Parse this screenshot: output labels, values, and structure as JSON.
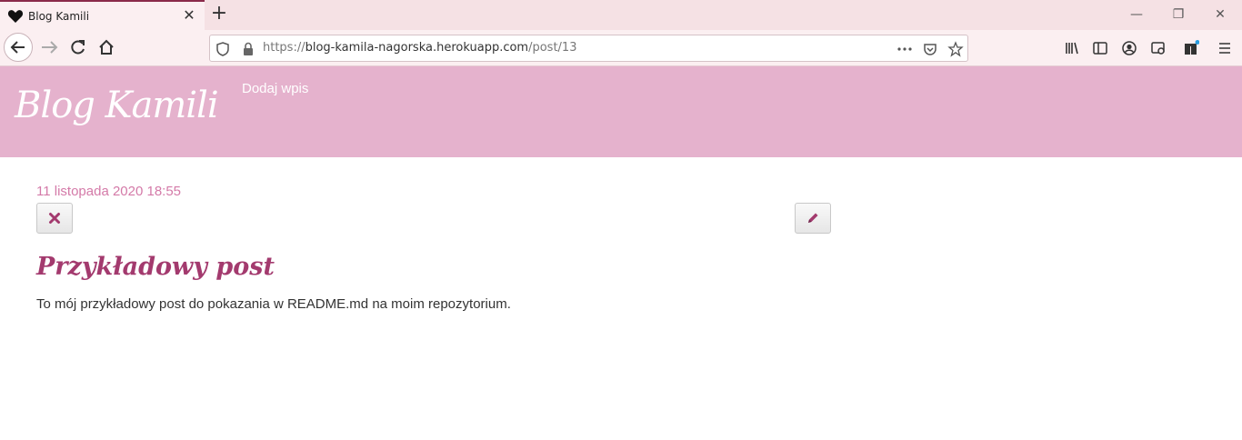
{
  "browser": {
    "tab_title": "Blog Kamili",
    "url_scheme": "https://",
    "url_host": "blog-kamila-nagorska.herokuapp.com",
    "url_path": "/post/13",
    "icons": [
      "heart-icon",
      "close-icon",
      "plus-icon",
      "back-icon",
      "forward-icon",
      "reload-icon",
      "home-icon",
      "shield-icon",
      "lock-icon",
      "more-icon",
      "pocket-icon",
      "star-icon",
      "library-icon",
      "sidebar-icon",
      "account-icon",
      "screenshot-icon",
      "extensions-icon",
      "menu-icon",
      "minimize-icon",
      "restore-icon",
      "window-close-icon"
    ]
  },
  "site": {
    "brand": "Blog Kamili",
    "nav": {
      "add_post": "Dodaj wpis"
    },
    "header_color": "#e5b2cd"
  },
  "post": {
    "date": "11 listopada 2020 18:55",
    "title": "Przykładowy post",
    "body": "To mój przykładowy post do pokazania w README.md na moim repozytorium.",
    "delete_icon": "x-icon",
    "edit_icon": "pencil-icon",
    "accent": "#a33a6e"
  }
}
